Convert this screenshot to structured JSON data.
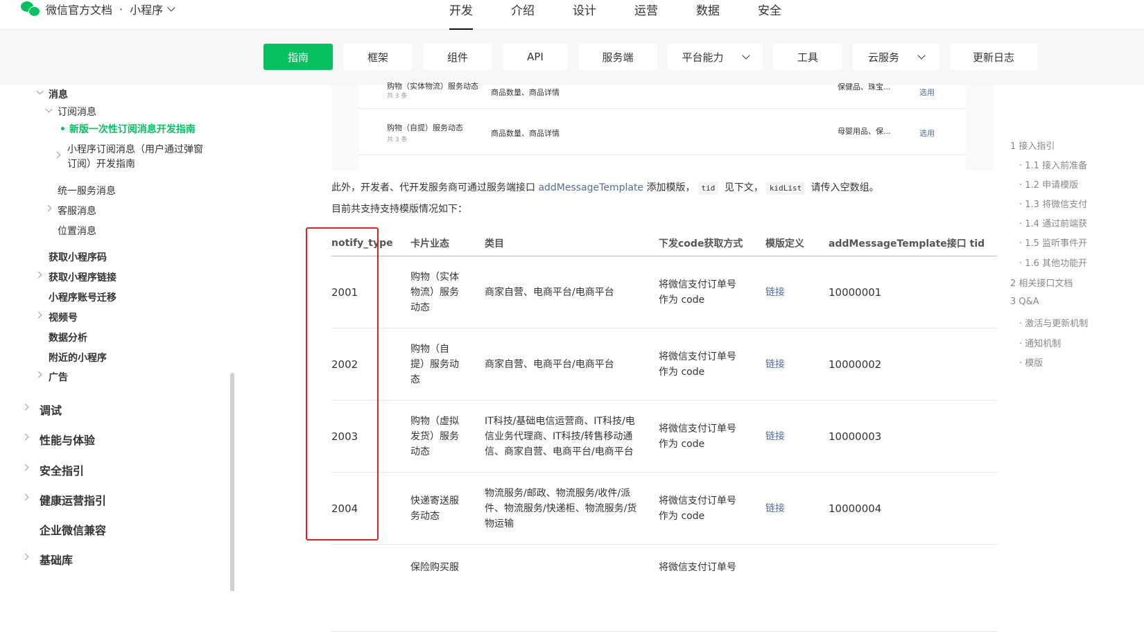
{
  "header": {
    "logo_text": "微信官方文档",
    "dot": "·",
    "product": "小程序",
    "nav": [
      "开发",
      "介绍",
      "设计",
      "运营",
      "数据",
      "安全"
    ]
  },
  "subnav": {
    "items": [
      "指南",
      "框架",
      "组件",
      "API",
      "服务端",
      "平台能力",
      "工具",
      "云服务",
      "更新日志"
    ]
  },
  "sidebar": {
    "xiaoxi": "消息",
    "dingyue": "订阅消息",
    "active_item": "• 新版一次性订阅消息开发指南",
    "dingyue_guide_line1": "小程序订阅消息（用户通过弹窗",
    "dingyue_guide_line2": "订阅）开发指南",
    "tongyi": "统一服务消息",
    "kefu": "客服消息",
    "weizhi": "位置消息",
    "huoqu_ma": "获取小程序码",
    "huoqu_lianjie": "获取小程序链接",
    "zhanghao": "小程序账号迁移",
    "shipinhao": "视频号",
    "shuju": "数据分析",
    "fujin": "附近的小程序",
    "guanggao": "广告",
    "tiaoshi": "调试",
    "xingneng": "性能与体验",
    "anquan": "安全指引",
    "jiankang": "健康运营指引",
    "qiye": "企业微信兼容",
    "jichuku": "基础库"
  },
  "preview": {
    "row1_title": "购物（实体物流）服务动态",
    "row1_count": "共 3 条",
    "row1_cat": "商品数量、商品详情",
    "row1_tag": "保健品、珠宝...",
    "row1_action": "选用",
    "row2_title": "购物（自提）服务动态",
    "row2_count": "共 3 条",
    "row2_cat": "商品数量、商品详情",
    "row2_tag": "母婴用品、保...",
    "row2_action": "选用"
  },
  "intro": {
    "p1_a": "此外，开发者、代开发服务商可通过服务端接口 ",
    "p1_link": "addMessageTemplate",
    "p1_b": " 添加模版，",
    "p1_code1": "tid",
    "p1_c": " 见下文，",
    "p1_code2": "kidList",
    "p1_d": " 请传入空数组。",
    "p2": "目前共支持支持模版情况如下："
  },
  "table": {
    "headers": [
      "notify_type",
      "卡片业态",
      "类目",
      "下发code获取方式",
      "模版定义",
      "addMessageTemplate接口 tid"
    ],
    "rows": [
      {
        "type": "2001",
        "biz_l1": "购物（实体",
        "biz_l2": "物流）服务",
        "biz_l3": "动态",
        "cat_l1": "商家自营、电商平台/电商平台",
        "cat_l2": "",
        "cat_l3": "",
        "code_l1": "将微信支付订单号",
        "code_l2": "作为 code",
        "def": "链接",
        "tid": "10000001"
      },
      {
        "type": "2002",
        "biz_l1": "购物（自",
        "biz_l2": "提）服务动",
        "biz_l3": "态",
        "cat_l1": "商家自营、电商平台/电商平台",
        "cat_l2": "",
        "cat_l3": "",
        "code_l1": "将微信支付订单号",
        "code_l2": "作为 code",
        "def": "链接",
        "tid": "10000002"
      },
      {
        "type": "2003",
        "biz_l1": "购物（虚拟",
        "biz_l2": "发货）服务",
        "biz_l3": "动态",
        "cat_l1": "IT科技/基础电信运营商、IT科技/电",
        "cat_l2": "信业务代理商、IT科技/转售移动通",
        "cat_l3": "信、商家自营、电商平台/电商平台",
        "code_l1": "将微信支付订单号",
        "code_l2": "作为 code",
        "def": "链接",
        "tid": "10000003"
      },
      {
        "type": "2004",
        "biz_l1": "快递寄送服",
        "biz_l2": "务动态",
        "biz_l3": "",
        "cat_l1": "物流服务/邮政、物流服务/收件/派",
        "cat_l2": "件、物流服务/快递柜、物流服务/货",
        "cat_l3": "物运输",
        "code_l1": "将微信支付订单号",
        "code_l2": "作为 code",
        "def": "链接",
        "tid": "10000004"
      },
      {
        "type": "",
        "biz_l1": "保险购买服",
        "biz_l2": "",
        "biz_l3": "",
        "cat_l1": "",
        "cat_l2": "",
        "cat_l3": "",
        "code_l1": "将微信支付订单号",
        "code_l2": "",
        "def": "",
        "tid": ""
      }
    ]
  },
  "toc": {
    "items": [
      "1 接入指引",
      "· 1.1 接入前准备",
      "· 1.2 申请模版",
      "· 1.3 将微信支付",
      "· 1.4 通过前端获",
      "· 1.5 监听事件开",
      "· 1.6 其他功能开",
      "2 相关接口文档",
      "3 Q&A",
      "· 激活与更新机制",
      "· 通知机制",
      "· 模版"
    ]
  },
  "colors": {
    "accent": "#07c160",
    "link": "#576b95",
    "highlight_box": "#e02020"
  }
}
